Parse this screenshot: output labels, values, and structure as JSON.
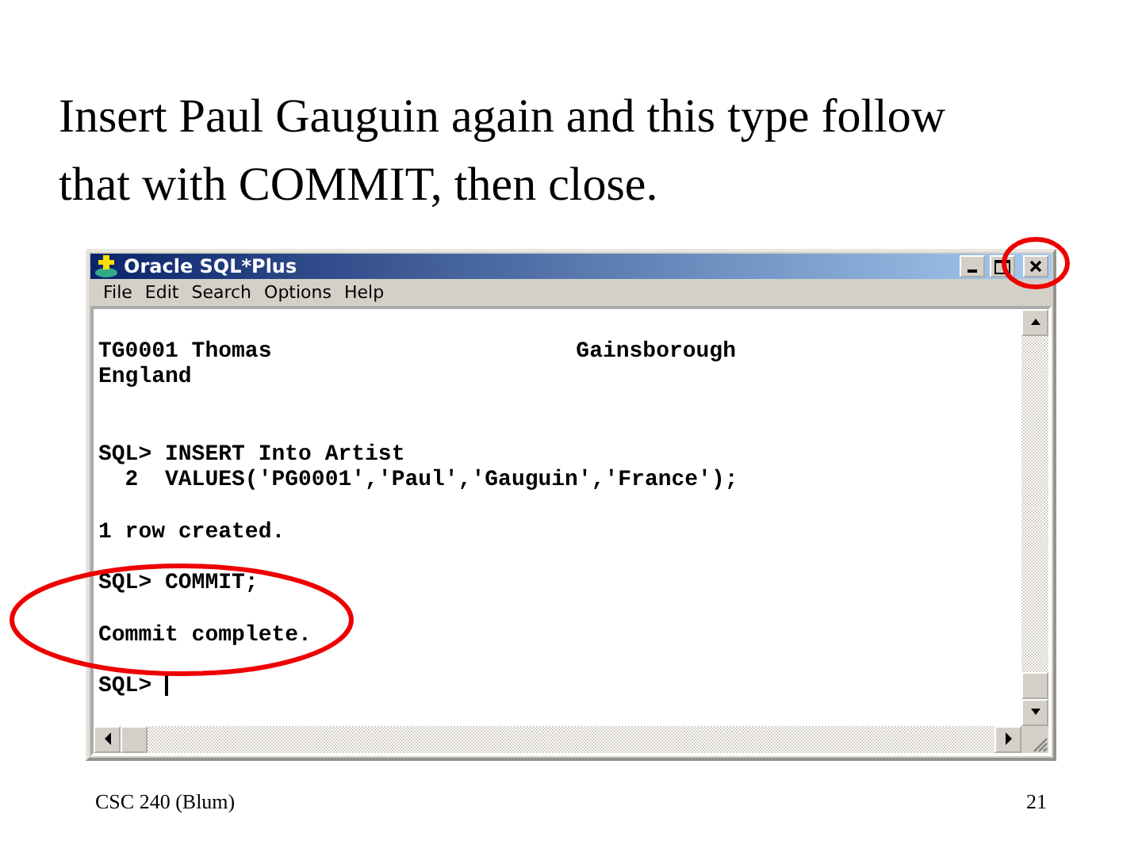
{
  "slide": {
    "title": "Insert Paul Gauguin again and this type follow that with COMMIT, then close.",
    "footer": "CSC 240 (Blum)",
    "page_number": "21"
  },
  "window": {
    "title": "Oracle SQL*Plus",
    "menu": [
      "File",
      "Edit",
      "Search",
      "Options",
      "Help"
    ]
  },
  "console": {
    "blocks": [
      [
        [
          "TG0001 Thomas",
          "Gainsborough"
        ],
        [
          "England"
        ]
      ],
      [
        [
          "SQL> INSERT Into Artist"
        ],
        [
          "  2  VALUES('PG0001','Paul','Gauguin','France');"
        ]
      ],
      [
        [
          "1 row created."
        ]
      ],
      [
        [
          "SQL> COMMIT;"
        ]
      ],
      [
        [
          "Commit complete."
        ]
      ],
      [
        [
          "SQL> "
        ]
      ]
    ]
  },
  "annotations": {
    "close_button_circled": true,
    "commit_circled": true
  }
}
